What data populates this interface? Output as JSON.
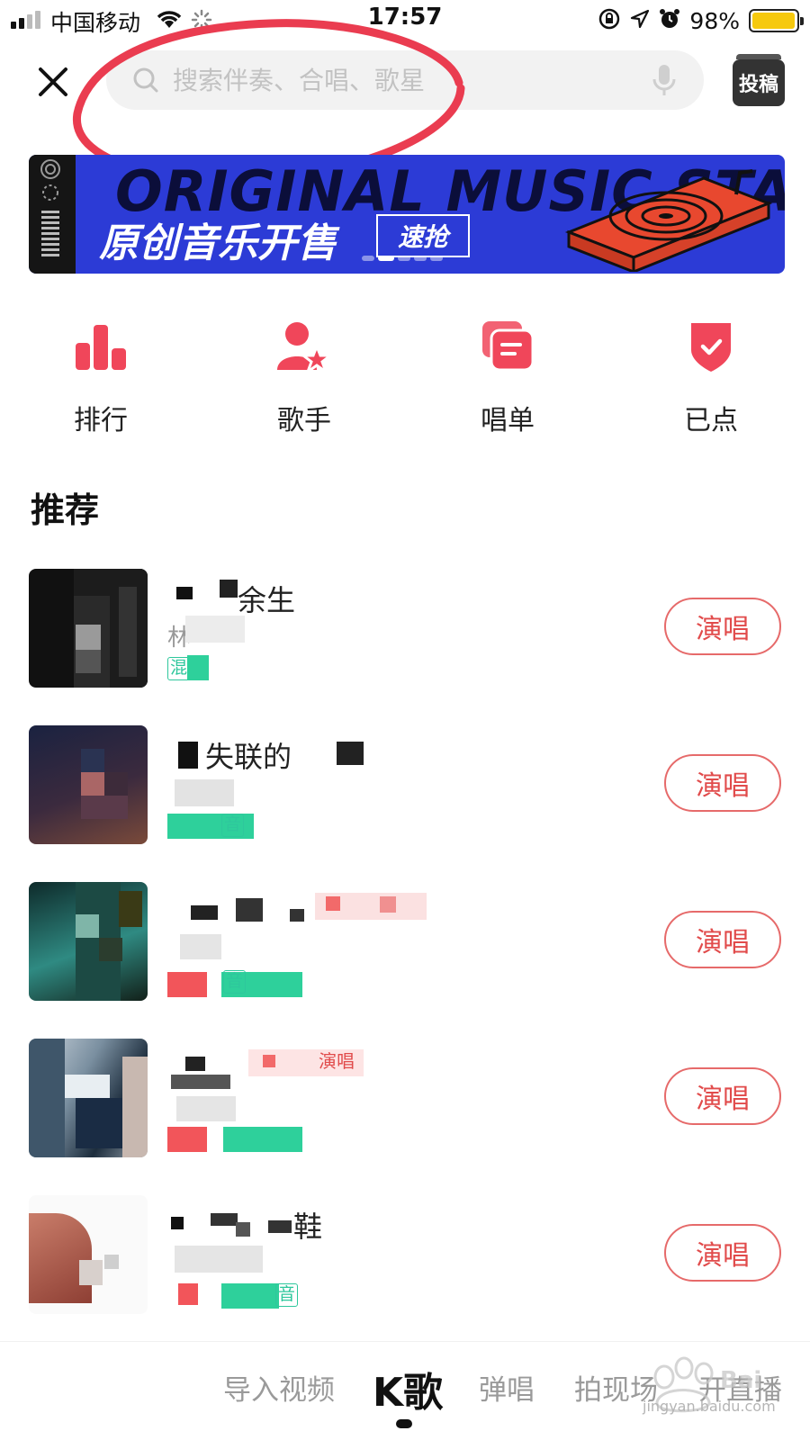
{
  "status_bar": {
    "carrier": "中国移动",
    "time": "17:57",
    "battery_percent": "98%",
    "battery_level": 0.98,
    "icons": [
      "signal-icon",
      "wifi-icon",
      "loading-icon",
      "orientation-lock-icon",
      "location-icon",
      "alarm-icon",
      "battery-icon"
    ]
  },
  "header": {
    "close_icon": "close-icon",
    "search_placeholder": "搜索伴奏、合唱、歌星",
    "search_value": "",
    "mic_icon": "mic-icon",
    "submit_label": "投稿"
  },
  "banner": {
    "bg_text": "ORIGINAL MUSIC STAR",
    "title": "原创音乐开售",
    "tag": "速抢",
    "slide_index": 1,
    "slide_count": 5,
    "colors": {
      "background": "#2c3bd6",
      "accent": "#e8482f"
    }
  },
  "quick_nav": [
    {
      "label": "排行",
      "icon": "bar-chart-icon"
    },
    {
      "label": "歌手",
      "icon": "singer-star-icon"
    },
    {
      "label": "唱单",
      "icon": "playlist-icon"
    },
    {
      "label": "已点",
      "icon": "checked-shield-icon"
    }
  ],
  "section": {
    "title": "推荐"
  },
  "songs": [
    {
      "title": "余生",
      "artist": "林",
      "badge": "混",
      "button": "演唱"
    },
    {
      "title": "失联的",
      "artist": "",
      "badge": "音",
      "button": "演唱"
    },
    {
      "title": "",
      "artist": "",
      "badge": "音",
      "button": "演唱"
    },
    {
      "title": "",
      "artist": "",
      "badge": "演唱",
      "button": "演唱"
    },
    {
      "title": "鞋",
      "artist": "",
      "badge": "音",
      "button": "演唱"
    }
  ],
  "bottom_tabs": [
    {
      "label": "导入视频",
      "active": false
    },
    {
      "label": "K歌",
      "active": true
    },
    {
      "label": "弹唱",
      "active": false
    },
    {
      "label": "拍现场",
      "active": false
    },
    {
      "label": "开直播",
      "active": false
    }
  ],
  "watermark": {
    "text": "jingyan.baidu.com"
  },
  "colors": {
    "accent": "#f0465a",
    "sing_button": "#e14b4b",
    "badge": "#2ec79c",
    "annotation": "#ea3c50"
  }
}
